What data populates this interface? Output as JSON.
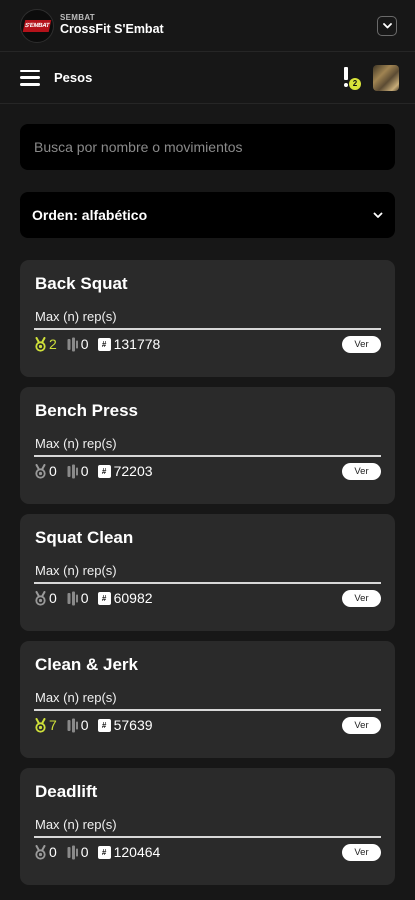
{
  "header": {
    "box_small": "SEMBAT",
    "box_name": "CrossFit S'Embat",
    "logo_text": "S'EMBAT"
  },
  "nav": {
    "title": "Pesos",
    "notification_count": "2"
  },
  "search": {
    "placeholder": "Busca por nombre o movimientos",
    "value": ""
  },
  "sort": {
    "label": "Orden: alfabético"
  },
  "colors": {
    "accent": "#cfe03a",
    "card": "#2a2a2a",
    "background": "#171717"
  },
  "icons": {
    "menu": "hamburger-icon",
    "notification": "exclamation-icon",
    "medal": "medal-icon",
    "plate": "weights-icon",
    "rank": "leaderboard-icon",
    "dropdown": "chevron-down-icon"
  },
  "cards": [
    {
      "title": "Back Squat",
      "subtitle": "Max (n) rep(s)",
      "medals": "2",
      "plates": "0",
      "rank": "131778",
      "button": "Ver",
      "medals_active": true
    },
    {
      "title": "Bench Press",
      "subtitle": "Max (n) rep(s)",
      "medals": "0",
      "plates": "0",
      "rank": "72203",
      "button": "Ver",
      "medals_active": false
    },
    {
      "title": "Squat Clean",
      "subtitle": "Max (n) rep(s)",
      "medals": "0",
      "plates": "0",
      "rank": "60982",
      "button": "Ver",
      "medals_active": false
    },
    {
      "title": "Clean & Jerk",
      "subtitle": "Max (n) rep(s)",
      "medals": "7",
      "plates": "0",
      "rank": "57639",
      "button": "Ver",
      "medals_active": true
    },
    {
      "title": "Deadlift",
      "subtitle": "Max (n) rep(s)",
      "medals": "0",
      "plates": "0",
      "rank": "120464",
      "button": "Ver",
      "medals_active": false
    }
  ]
}
